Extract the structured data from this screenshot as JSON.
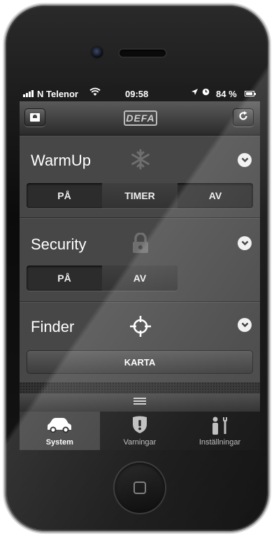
{
  "status_bar": {
    "carrier": "N Telenor",
    "time": "09:58",
    "battery": "84 %",
    "icons": [
      "signal-bars-icon",
      "wifi-icon",
      "location-arrow-icon",
      "alarm-clock-icon",
      "battery-icon"
    ]
  },
  "nav_bar": {
    "logo_text": "DEFA",
    "left_button_icon": "contact-card-icon",
    "right_button_icon": "refresh-icon"
  },
  "sections": {
    "warmup": {
      "title": "WarmUp",
      "icon": "snowflake-icon",
      "options": [
        "PÅ",
        "TIMER",
        "AV"
      ],
      "selected": "TIMER"
    },
    "security": {
      "title": "Security",
      "icon": "lock-icon",
      "options": [
        "PÅ",
        "AV"
      ],
      "selected": "AV"
    },
    "finder": {
      "title": "Finder",
      "icon": "crosshair-icon",
      "button_label": "KARTA"
    }
  },
  "tab_bar": {
    "tabs": [
      {
        "label": "System",
        "icon": "car-icon",
        "active": true
      },
      {
        "label": "Varningar",
        "icon": "warning-shield-icon",
        "active": false
      },
      {
        "label": "Inställningar",
        "icon": "person-wrench-icon",
        "active": false
      }
    ]
  },
  "colors": {
    "screen_bg": "#3b3b3b",
    "section_bg": "#474747",
    "tabbar_bg": "#151515"
  }
}
